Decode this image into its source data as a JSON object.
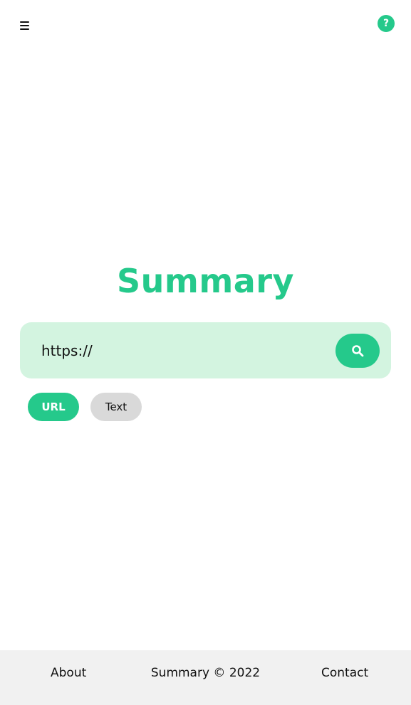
{
  "header": {
    "menu_icon": "hamburger-menu-icon",
    "help_icon": "question-mark-icon",
    "help_label": "?"
  },
  "main": {
    "title": "Summary",
    "search": {
      "value": "https://",
      "button_icon": "search-icon"
    },
    "modes": [
      {
        "label": "URL",
        "selected": true
      },
      {
        "label": "Text",
        "selected": false
      }
    ]
  },
  "footer": {
    "about": "About",
    "copyright": "Summary © 2022",
    "contact": "Contact"
  },
  "colors": {
    "accent": "#25c98b",
    "search_bg": "#d3f4e0",
    "inactive_pill": "#d9d9d9",
    "footer_bg": "#f1f1f1"
  }
}
